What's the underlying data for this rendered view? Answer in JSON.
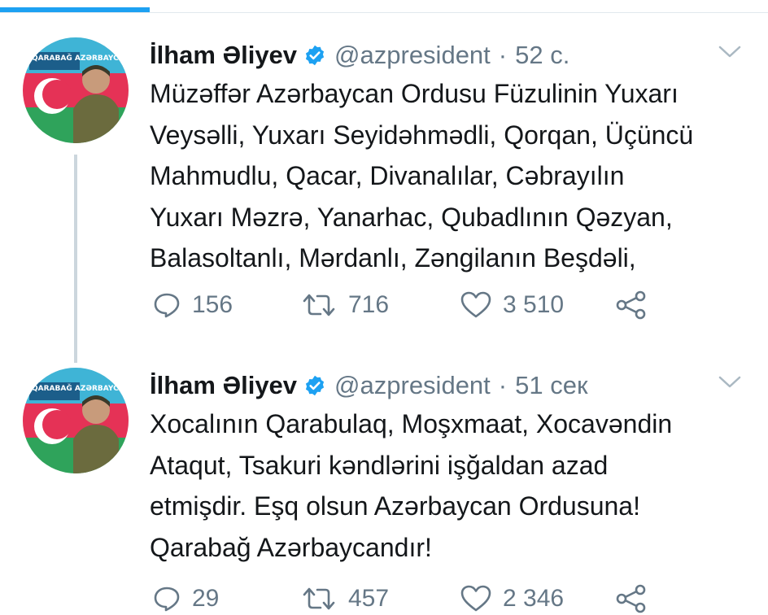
{
  "colors": {
    "accent": "#1da1f2",
    "text": "#14171a",
    "muted": "#657786",
    "divider": "#e1e8ed",
    "thread_line": "#ccd6dd"
  },
  "progress": {
    "value": 0.195
  },
  "tweets": [
    {
      "author": {
        "name": "İlham Əliyev",
        "handle": "@azpresident",
        "verified_icon": "verified-badge-icon",
        "avatar_text": "QARABAĞ AZƏRBAYCANDIR!"
      },
      "separator": "·",
      "time": "52 с.",
      "text_lines": [
        "Müzəffər Azərbaycan Ordusu Füzulinin Yuxarı",
        "Veysəlli, Yuxarı Seyidəhmədli, Qorqan, Üçüncü",
        "Mahmudlu, Qacar, Divanalılar, Cəbrayılın",
        "Yuxarı Məzrə, Yanarhac, Qubadlının Qəzyan,",
        "Balasoltanlı, Mərdanlı, Zəngilanın Beşdəli,"
      ],
      "actions": {
        "replies": "156",
        "retweets": "716",
        "likes": "3 510"
      }
    },
    {
      "author": {
        "name": "İlham Əliyev",
        "handle": "@azpresident",
        "verified_icon": "verified-badge-icon",
        "avatar_text": "QARABAĞ AZƏRBAYCANDIR!"
      },
      "separator": "·",
      "time": "51 сек",
      "text_lines": [
        "Xocalının Qarabulaq, Moşxmaat, Xocavəndin",
        "Ataqut, Tsakuri kəndlərini işğaldan azad",
        "etmişdir. Eşq olsun Azərbaycan Ordusuna!",
        "Qarabağ Azərbaycandır!"
      ],
      "actions": {
        "replies": "29",
        "retweets": "457",
        "likes": "2 346"
      }
    }
  ]
}
